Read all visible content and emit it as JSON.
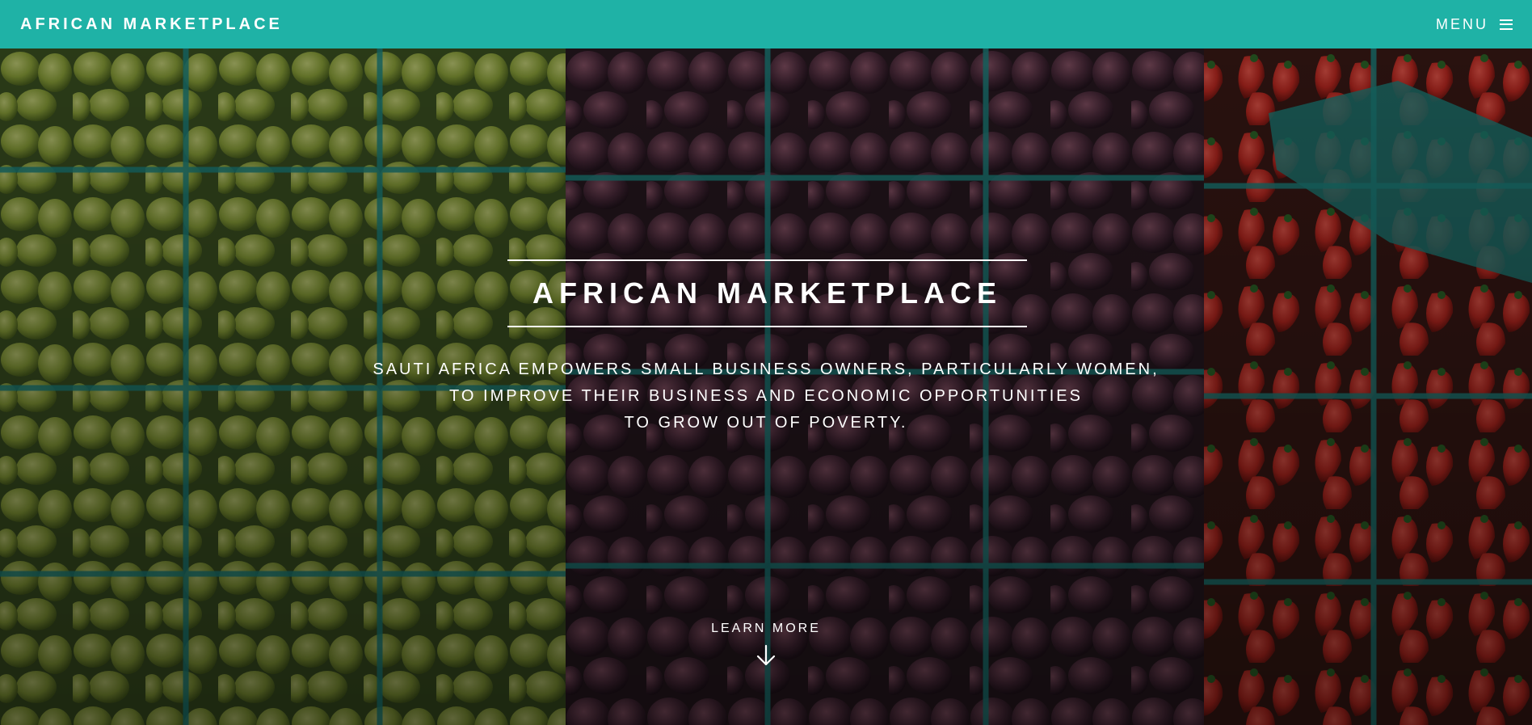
{
  "navbar": {
    "brand": "AFRICAN MARKETPLACE",
    "menu_label": "MENU",
    "menu_icon": "hamburger-icon",
    "bg_color": "#1fb2a6"
  },
  "hero": {
    "background": "market produce photo: green pears, purple figs, strawberries in teal baskets",
    "title": "AFRICAN MARKETPLACE",
    "tagline_lines": [
      "SAUTI AFRICA EMPOWERS SMALL BUSINESS OWNERS, PARTICULARLY WOMEN,",
      "TO IMPROVE THEIR BUSINESS AND ECONOMIC OPPORTUNITIES",
      "TO GROW OUT OF POVERTY."
    ],
    "cta_label": "LEARN MORE",
    "cta_icon": "arrow-down-icon"
  }
}
